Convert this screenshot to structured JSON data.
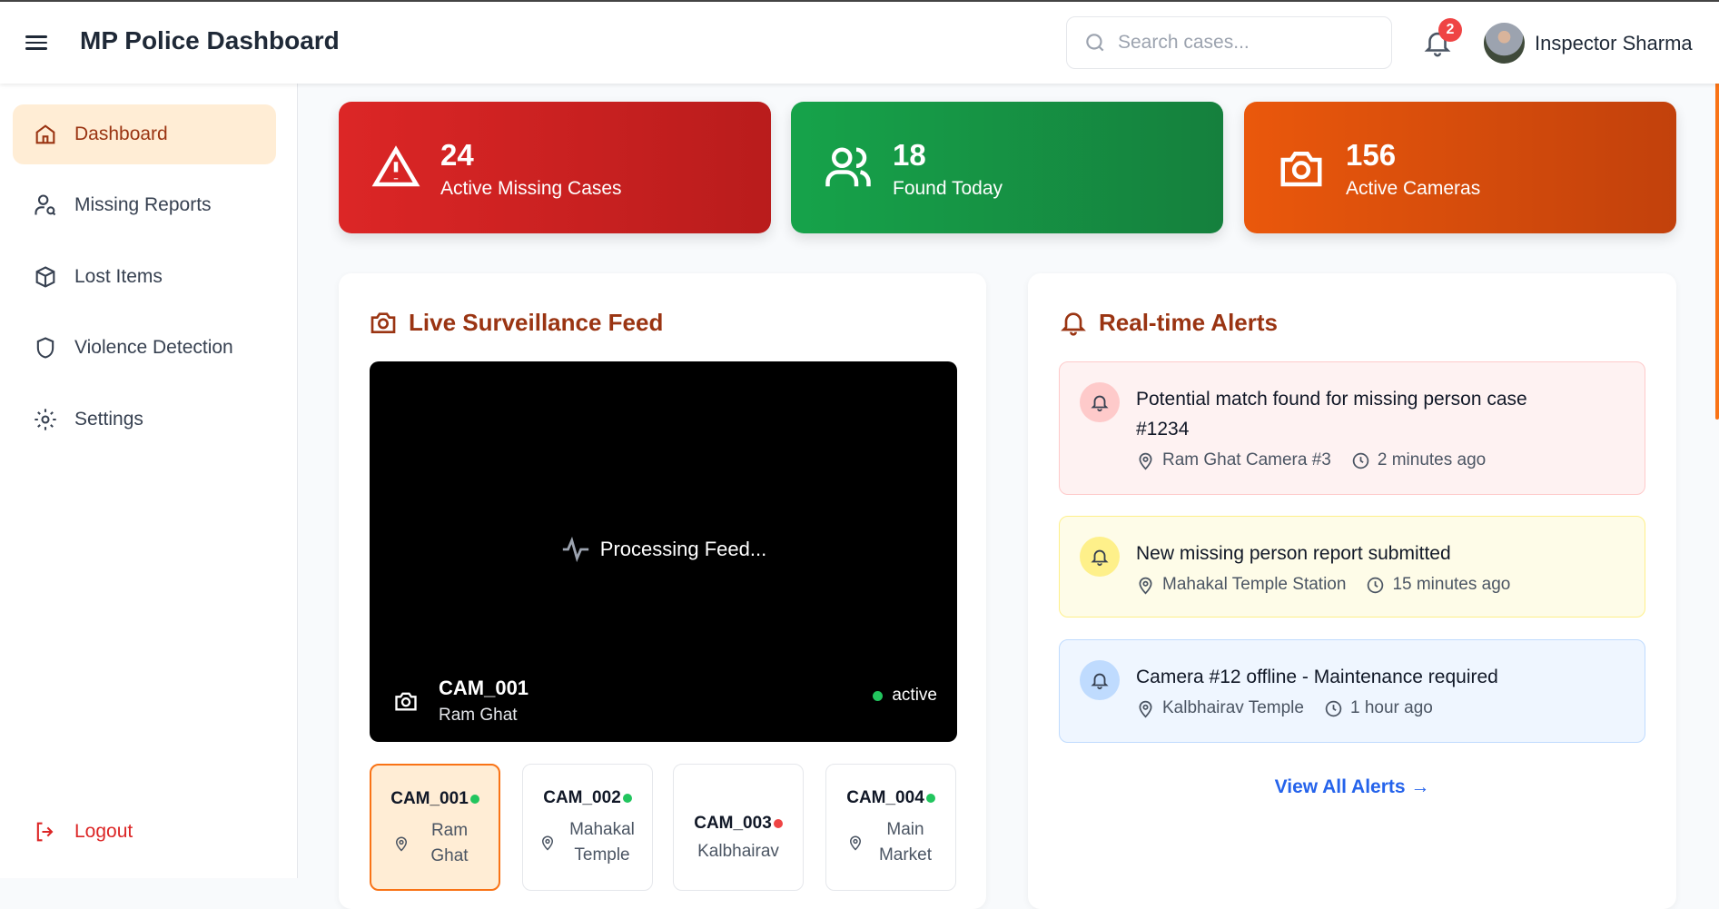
{
  "header": {
    "title": "MP Police Dashboard",
    "search_placeholder": "Search cases...",
    "notification_count": "2",
    "user_name": "Inspector Sharma"
  },
  "sidebar": {
    "items": [
      {
        "label": "Dashboard"
      },
      {
        "label": "Missing Reports"
      },
      {
        "label": "Lost Items"
      },
      {
        "label": "Violence Detection"
      },
      {
        "label": "Settings"
      }
    ],
    "logout": "Logout"
  },
  "stats": [
    {
      "value": "24",
      "label": "Active Missing Cases",
      "color": "#dc2626"
    },
    {
      "value": "18",
      "label": "Found Today",
      "color": "#16a34a"
    },
    {
      "value": "156",
      "label": "Active Cameras",
      "color": "#ea580c"
    }
  ],
  "feed": {
    "title": "Live Surveillance Feed",
    "processing": "Processing Feed...",
    "camera_id": "CAM_001",
    "camera_location": "Ram Ghat",
    "status": "active",
    "cameras": [
      {
        "id": "CAM_001",
        "location": "Ram Ghat",
        "status": "online"
      },
      {
        "id": "CAM_002",
        "location": "Mahakal Temple",
        "status": "online"
      },
      {
        "id": "CAM_003",
        "location": "Kalbhairav",
        "status": "offline"
      },
      {
        "id": "CAM_004",
        "location": "Main Market",
        "status": "online"
      }
    ]
  },
  "alerts": {
    "title": "Real-time Alerts",
    "items": [
      {
        "message": "Potential match found for missing person case #1234",
        "location": "Ram Ghat Camera #3",
        "time": "2 minutes ago"
      },
      {
        "message": "New missing person report submitted",
        "location": "Mahakal Temple Station",
        "time": "15 minutes ago"
      },
      {
        "message": "Camera #12 offline - Maintenance required",
        "location": "Kalbhairav Temple",
        "time": "1 hour ago"
      }
    ],
    "view_all": "View All Alerts →"
  }
}
